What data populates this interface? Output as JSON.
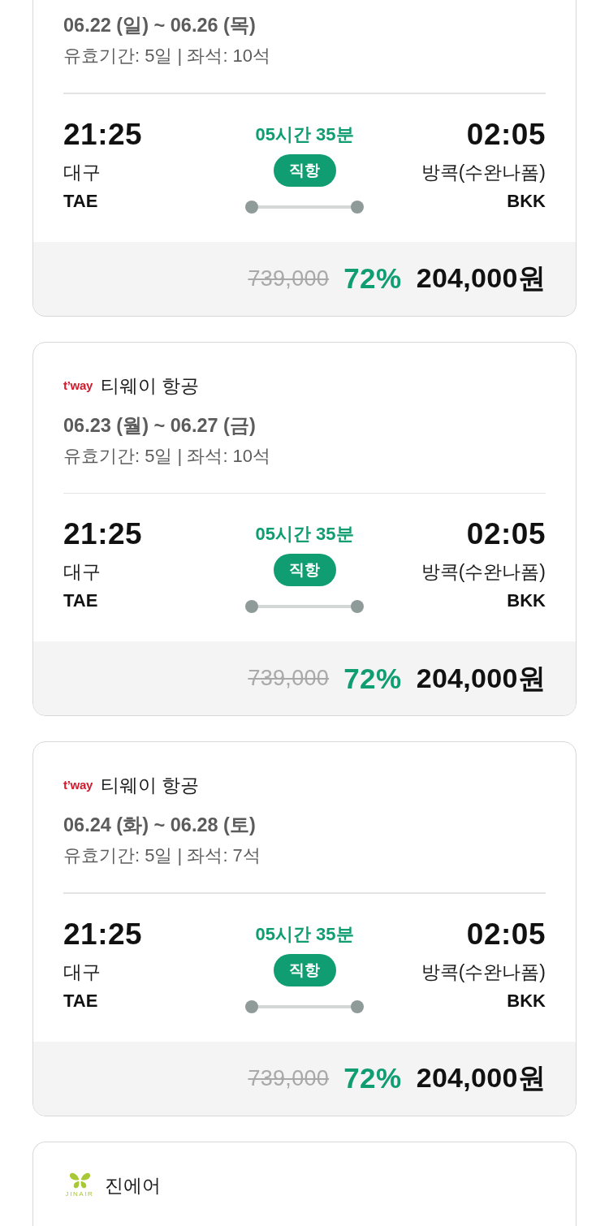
{
  "flights": [
    {
      "dates": "06.22 (일) ~ 06.26 (목)",
      "validity": "유효기간: 5일 | 좌석: 10석",
      "departure": {
        "time": "21:25",
        "city": "대구",
        "code": "TAE"
      },
      "duration": "05시간 35분",
      "route_type": "직항",
      "arrival": {
        "time": "02:05",
        "city": "방콕(수완나폼)",
        "code": "BKK"
      },
      "original_price": "739,000",
      "discount": "72%",
      "price": "204,000원"
    },
    {
      "airline": {
        "name": "티웨이 항공",
        "logo": {
          "kind": "tway",
          "text": "t’way"
        }
      },
      "dates": "06.23 (월) ~ 06.27 (금)",
      "validity": "유효기간: 5일 | 좌석: 10석",
      "departure": {
        "time": "21:25",
        "city": "대구",
        "code": "TAE"
      },
      "duration": "05시간 35분",
      "route_type": "직항",
      "arrival": {
        "time": "02:05",
        "city": "방콕(수완나폼)",
        "code": "BKK"
      },
      "original_price": "739,000",
      "discount": "72%",
      "price": "204,000원"
    },
    {
      "airline": {
        "name": "티웨이 항공",
        "logo": {
          "kind": "tway",
          "text": "t’way"
        }
      },
      "dates": "06.24 (화) ~ 06.28 (토)",
      "validity": "유효기간: 5일 | 좌석: 7석",
      "departure": {
        "time": "21:25",
        "city": "대구",
        "code": "TAE"
      },
      "duration": "05시간 35분",
      "route_type": "직항",
      "arrival": {
        "time": "02:05",
        "city": "방콕(수완나폼)",
        "code": "BKK"
      },
      "original_price": "739,000",
      "discount": "72%",
      "price": "204,000원"
    },
    {
      "airline": {
        "name": "진에어",
        "logo": {
          "kind": "jinair",
          "text": "JINAIR"
        }
      }
    }
  ]
}
